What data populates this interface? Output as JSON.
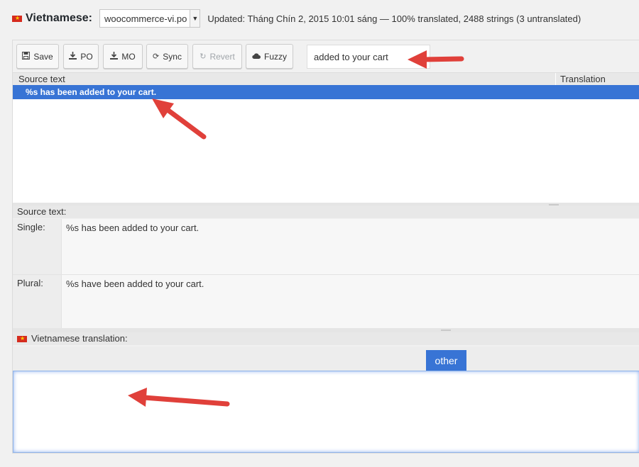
{
  "header": {
    "language": "Vietnamese:",
    "file": "woocommerce-vi.po",
    "meta": "Updated: Tháng Chín 2, 2015 10:01 sáng — 100% translated, 2488 strings (3 untranslated)"
  },
  "toolbar": {
    "save": "Save",
    "po": "PO",
    "mo": "MO",
    "sync": "Sync",
    "revert": "Revert",
    "fuzzy": "Fuzzy",
    "search_value": "added to your cart"
  },
  "grid": {
    "col_source": "Source text",
    "col_translation": "Translation",
    "rows": [
      {
        "source": "%s has been added to your cart.",
        "translation": ""
      }
    ]
  },
  "source_panel": {
    "title": "Source text:",
    "single_label": "Single:",
    "single_text": "%s has been added to your cart.",
    "plural_label": "Plural:",
    "plural_text": "%s have been added to your cart."
  },
  "translation_panel": {
    "title": "Vietnamese translation:",
    "tab": "other",
    "value": ""
  },
  "colors": {
    "accent": "#3874d5",
    "annotation_arrow": "#e0403a",
    "flag_red": "#d52b1e",
    "flag_star": "#ffcd00"
  },
  "icons": [
    "vietnam-flag-icon",
    "save-icon",
    "download-icon",
    "sync-icon",
    "revert-icon",
    "cloud-icon",
    "chevron-down-icon"
  ]
}
